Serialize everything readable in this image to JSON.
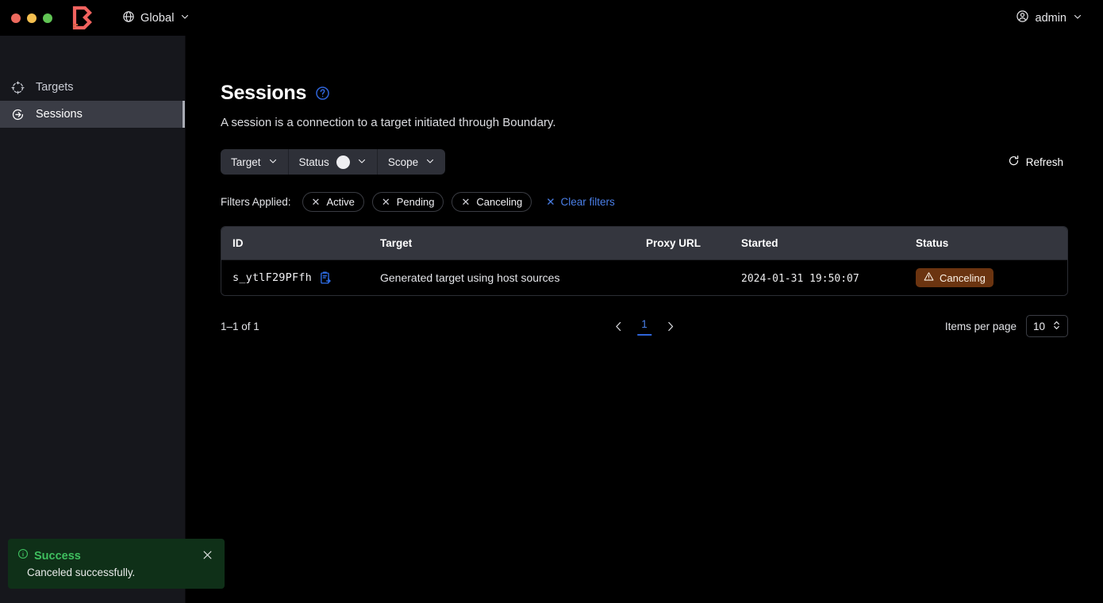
{
  "window": {
    "traffic_lights": [
      "close",
      "minimize",
      "maximize"
    ],
    "logo_name": "boundary-logo"
  },
  "topbar": {
    "scope": {
      "icon": "globe-icon",
      "label": "Global",
      "chevron": "chevron-down-icon"
    },
    "user": {
      "icon": "user-circle-icon",
      "label": "admin",
      "chevron": "chevron-down-icon"
    }
  },
  "sidebar": {
    "items": [
      {
        "label": "Targets",
        "icon": "target-icon",
        "active": false
      },
      {
        "label": "Sessions",
        "icon": "session-icon",
        "active": true
      }
    ]
  },
  "page": {
    "title": "Sessions",
    "help_icon": "help-circle-icon",
    "description": "A session is a connection to a target initiated through Boundary."
  },
  "filters": {
    "buttons": [
      {
        "label": "Target",
        "badge": null
      },
      {
        "label": "Status",
        "badge": "filter-count-badge"
      },
      {
        "label": "Scope",
        "badge": null
      }
    ],
    "refresh_label": "Refresh",
    "refresh_icon": "refresh-icon",
    "applied_label": "Filters Applied:",
    "applied": [
      "Active",
      "Pending",
      "Canceling"
    ],
    "clear_label": "Clear filters"
  },
  "table": {
    "columns": [
      "ID",
      "Target",
      "Proxy URL",
      "Started",
      "Status"
    ],
    "rows": [
      {
        "id": "s_ytlF29PFfh",
        "copy_icon": "copy-clipboard-icon",
        "target": "Generated target using host sources",
        "proxy_url": "",
        "started": "2024-01-31 19:50:07",
        "status": "Canceling",
        "status_icon": "warning-triangle-icon",
        "status_color": "#6b3410"
      }
    ]
  },
  "pagination": {
    "count_text": "1–1 of 1",
    "prev_icon": "chevron-left-icon",
    "next_icon": "chevron-right-icon",
    "current_page": "1",
    "per_page_label": "Items per page",
    "per_page_value": "10"
  },
  "toast": {
    "icon": "info-circle-icon",
    "title": "Success",
    "message": "Canceled successfully.",
    "close_icon": "close-icon",
    "accent": "#3fbf5f",
    "background": "#0f3018"
  }
}
